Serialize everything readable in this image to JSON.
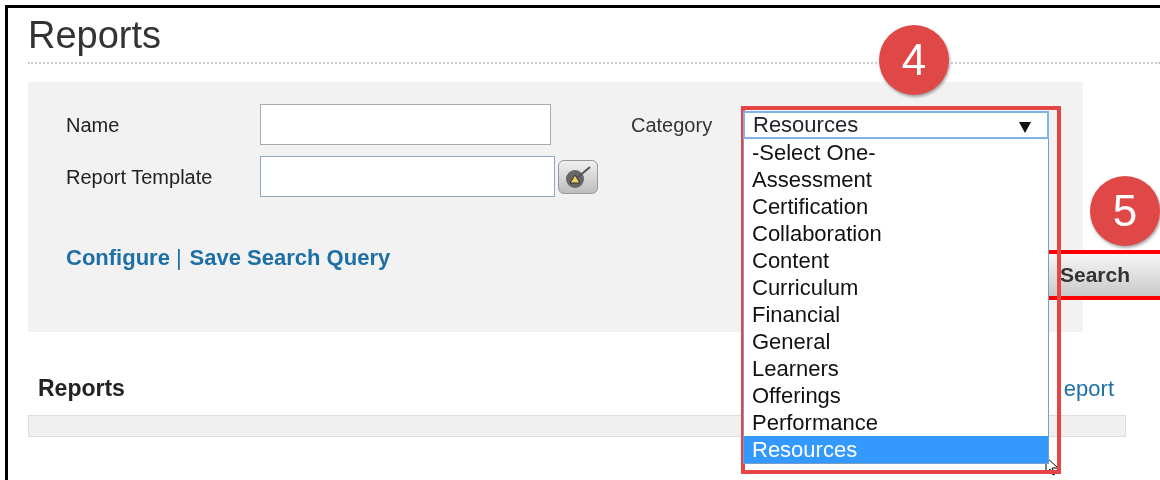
{
  "page_title": "Reports",
  "form": {
    "fields": [
      {
        "label": "Name",
        "kind": "text"
      },
      {
        "label": "Report Template",
        "kind": "picker"
      }
    ],
    "category": {
      "label": "Category",
      "value": "Resources",
      "expanded": true,
      "options": [
        {
          "label": "-Select One-",
          "selected": false
        },
        {
          "label": "Assessment",
          "selected": false
        },
        {
          "label": "Certification",
          "selected": false
        },
        {
          "label": "Collaboration",
          "selected": false
        },
        {
          "label": "Content",
          "selected": false
        },
        {
          "label": "Curriculum",
          "selected": false
        },
        {
          "label": "Financial",
          "selected": false
        },
        {
          "label": "General",
          "selected": false
        },
        {
          "label": "Learners",
          "selected": false
        },
        {
          "label": "Offerings",
          "selected": false
        },
        {
          "label": "Performance",
          "selected": false
        },
        {
          "label": "Resources",
          "selected": true
        }
      ]
    },
    "links": [
      {
        "label": "Configure"
      },
      {
        "label": "Save Search Query"
      }
    ],
    "link_separator": "|",
    "search_button": "Search"
  },
  "annotations": [
    {
      "number": "4"
    },
    {
      "number": "5"
    }
  ],
  "reports_section": {
    "title": "Reports",
    "link": "eport"
  }
}
